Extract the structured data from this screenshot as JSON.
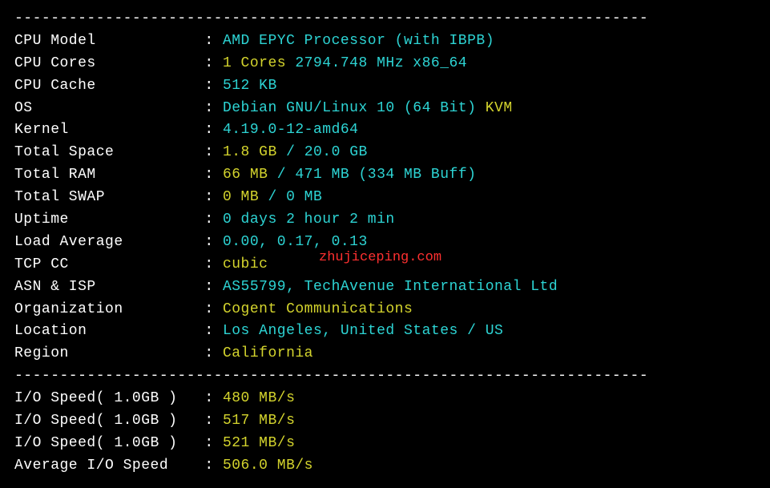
{
  "divider": "----------------------------------------------------------------------",
  "rows": [
    {
      "label": "CPU Model            ",
      "parts": [
        {
          "text": "AMD EPYC Processor (with IBPB)",
          "cls": "cyan"
        }
      ]
    },
    {
      "label": "CPU Cores            ",
      "parts": [
        {
          "text": "1 Cores ",
          "cls": "yellow"
        },
        {
          "text": "2794.748 MHz x86_64",
          "cls": "cyan"
        }
      ]
    },
    {
      "label": "CPU Cache            ",
      "parts": [
        {
          "text": "512 KB",
          "cls": "cyan"
        }
      ]
    },
    {
      "label": "OS                   ",
      "parts": [
        {
          "text": "Debian GNU/Linux 10 (64 Bit) ",
          "cls": "cyan"
        },
        {
          "text": "KVM",
          "cls": "yellow"
        }
      ]
    },
    {
      "label": "Kernel               ",
      "parts": [
        {
          "text": "4.19.0-12-amd64",
          "cls": "cyan"
        }
      ]
    },
    {
      "label": "Total Space          ",
      "parts": [
        {
          "text": "1.8 GB ",
          "cls": "yellow"
        },
        {
          "text": "/ ",
          "cls": "cyan"
        },
        {
          "text": "20.0 GB",
          "cls": "cyan"
        }
      ]
    },
    {
      "label": "Total RAM            ",
      "parts": [
        {
          "text": "66 MB ",
          "cls": "yellow"
        },
        {
          "text": "/ ",
          "cls": "cyan"
        },
        {
          "text": "471 MB ",
          "cls": "cyan"
        },
        {
          "text": "(334 MB Buff)",
          "cls": "cyan"
        }
      ]
    },
    {
      "label": "Total SWAP           ",
      "parts": [
        {
          "text": "0 MB ",
          "cls": "yellow"
        },
        {
          "text": "/ ",
          "cls": "cyan"
        },
        {
          "text": "0 MB",
          "cls": "cyan"
        }
      ]
    },
    {
      "label": "Uptime               ",
      "parts": [
        {
          "text": "0 days 2 hour 2 min",
          "cls": "cyan"
        }
      ]
    },
    {
      "label": "Load Average         ",
      "parts": [
        {
          "text": "0.00, 0.17, 0.13",
          "cls": "cyan"
        }
      ]
    },
    {
      "label": "TCP CC               ",
      "parts": [
        {
          "text": "cubic",
          "cls": "yellow"
        }
      ]
    },
    {
      "label": "ASN & ISP            ",
      "parts": [
        {
          "text": "AS55799, TechAvenue International Ltd",
          "cls": "cyan"
        }
      ]
    },
    {
      "label": "Organization         ",
      "parts": [
        {
          "text": "Cogent Communications",
          "cls": "yellow"
        }
      ]
    },
    {
      "label": "Location             ",
      "parts": [
        {
          "text": "Los Angeles, United States / US",
          "cls": "cyan"
        }
      ]
    },
    {
      "label": "Region               ",
      "parts": [
        {
          "text": "California",
          "cls": "yellow"
        }
      ]
    }
  ],
  "io_rows": [
    {
      "label": "I/O Speed( 1.0GB )   ",
      "value": "480 MB/s"
    },
    {
      "label": "I/O Speed( 1.0GB )   ",
      "value": "517 MB/s"
    },
    {
      "label": "I/O Speed( 1.0GB )   ",
      "value": "521 MB/s"
    },
    {
      "label": "Average I/O Speed    ",
      "value": "506.0 MB/s"
    }
  ],
  "watermark": "zhujiceping.com"
}
